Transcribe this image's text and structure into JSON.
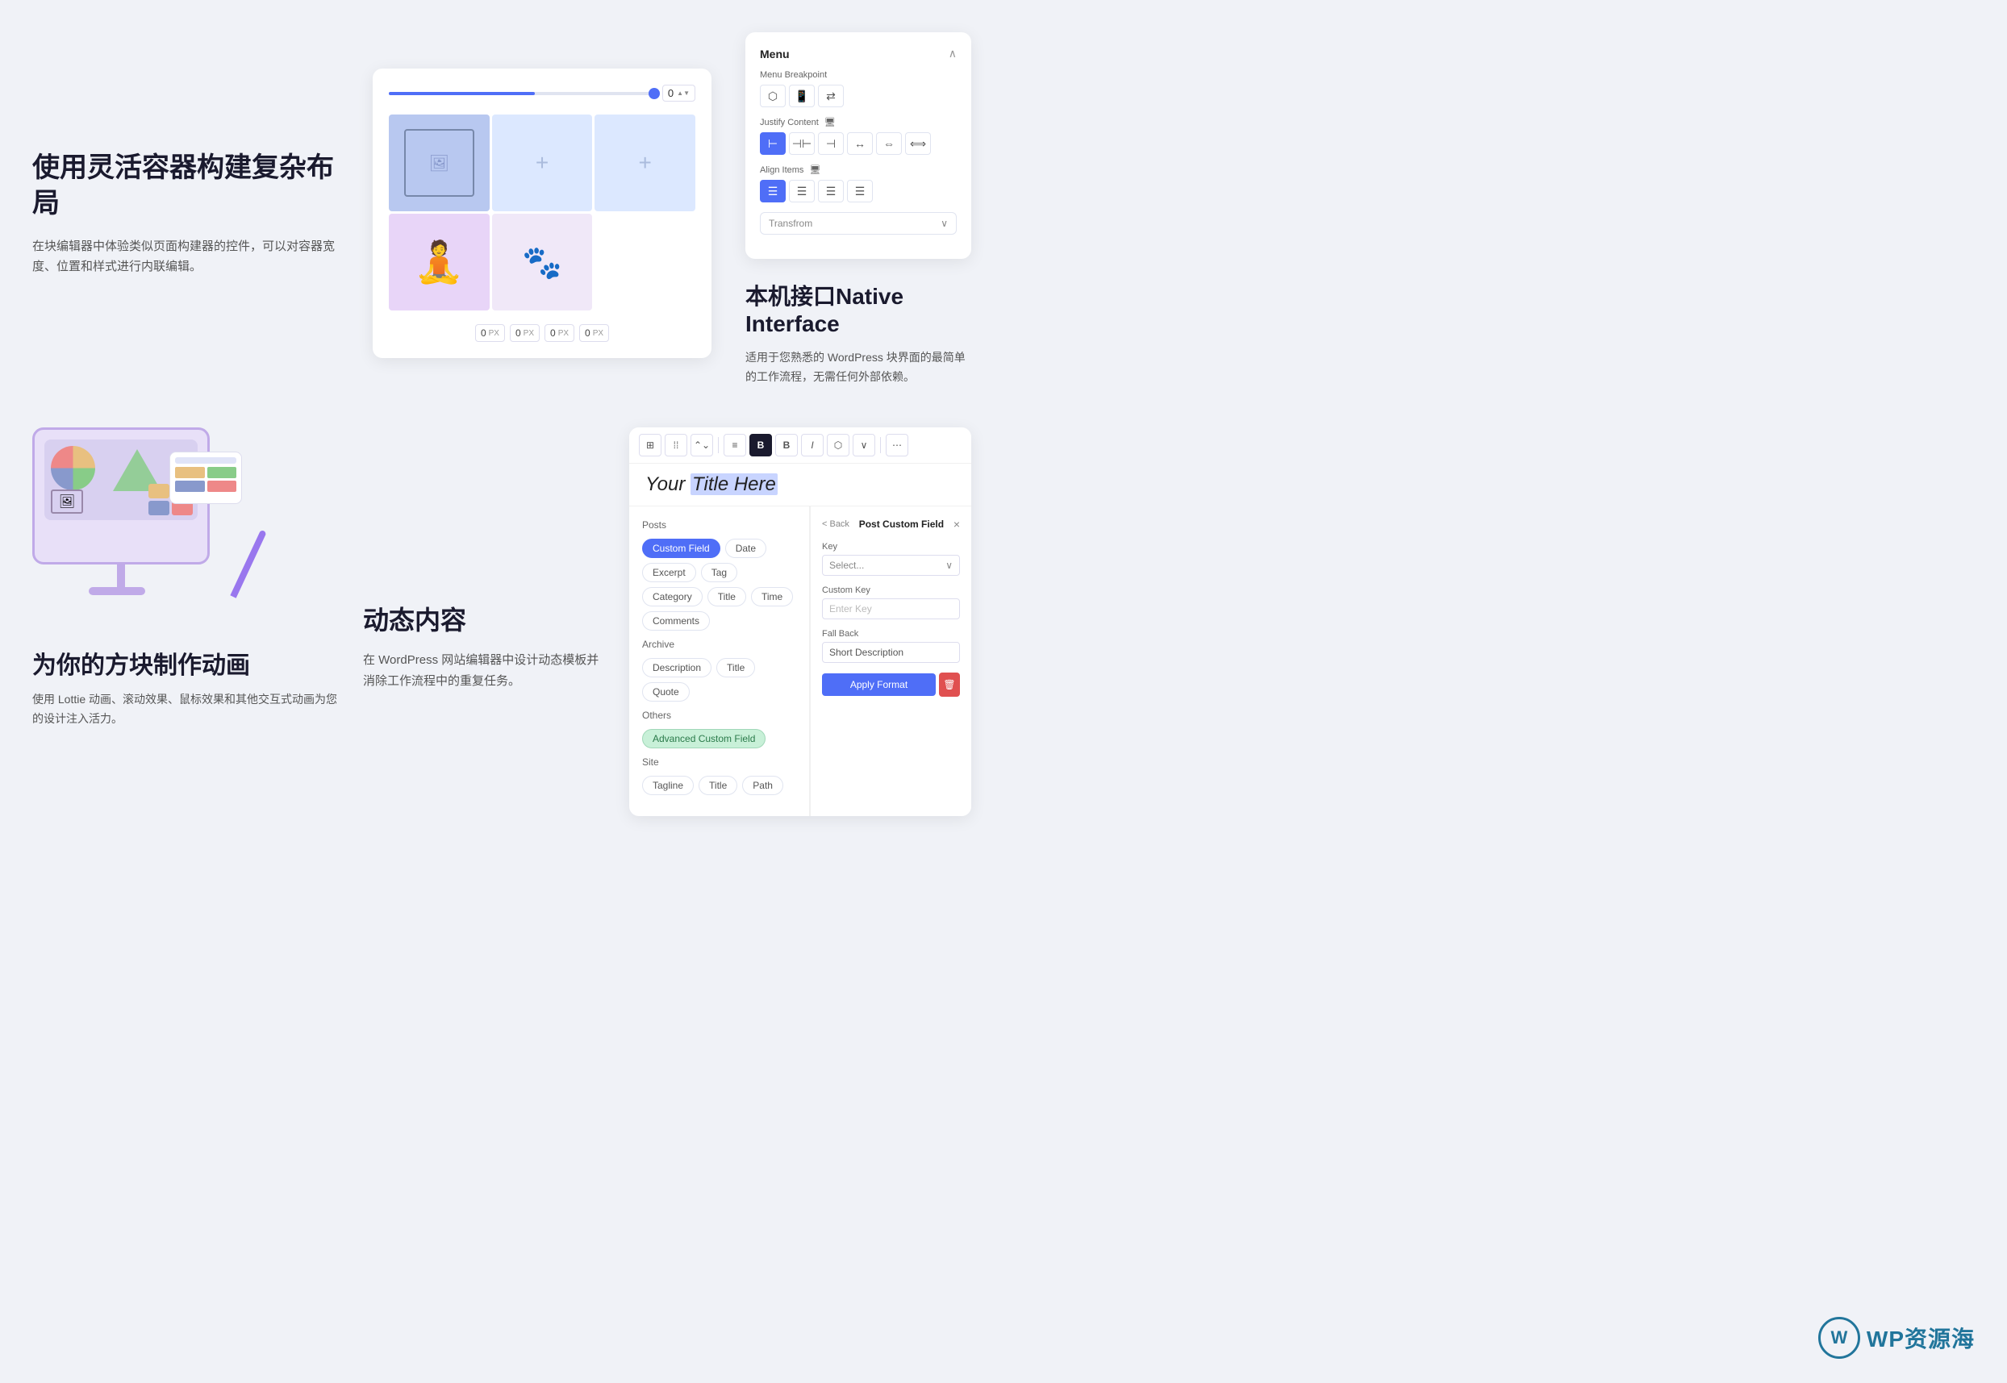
{
  "top_left": {
    "heading": "使用灵活容器构建复杂布局",
    "description": "在块编辑器中体验类似页面构建器的控件，可以对容器宽度、位置和样式进行内联编辑。"
  },
  "slider": {
    "value": "0",
    "unit": "PX"
  },
  "spacing": {
    "values": [
      "0",
      "0",
      "0",
      "0"
    ],
    "unit": "PX"
  },
  "top_right_panel": {
    "title": "Menu",
    "breakpoint_label": "Menu Breakpoint",
    "justify_label": "Justify Content",
    "align_label": "Align Items",
    "transform_label": "Transfrom"
  },
  "right_text": {
    "heading": "本机接口Native Interface",
    "description": "适用于您熟悉的 WordPress 块界面的最简单的工作流程，无需任何外部依赖。"
  },
  "bottom_left": {
    "heading": "为你的方块制作动画",
    "description": "使用 Lottie 动画、滚动效果、鼠标效果和其他交互式动画为您的设计注入活力。"
  },
  "bottom_center": {
    "heading": "动态内容",
    "description": "在 WordPress 网站编辑器中设计动态模板并消除工作流程中的重复任务。"
  },
  "editor": {
    "title_before": "Your ",
    "title_highlight": "Title Here",
    "toolbar_buttons": [
      "⊞",
      "⋮⋮",
      "∧∨",
      "≡",
      "B",
      "I",
      "⬡",
      "∨",
      "⋯"
    ],
    "posts_label": "Posts",
    "tags": [
      "Custom Field",
      "Date",
      "Excerpt",
      "Tag",
      "Category",
      "Title",
      "Time",
      "Comments"
    ],
    "archive_label": "Archive",
    "archive_tags": [
      "Description",
      "Title",
      "Quote"
    ],
    "others_label": "Others",
    "others_tags": [
      "Advanced Custom Field"
    ],
    "site_label": "Site",
    "site_tags": [
      "Tagline",
      "Title",
      "Path"
    ]
  },
  "custom_field_panel": {
    "back_text": "< Back",
    "title": "Post Custom Field",
    "close_icon": "×",
    "key_label": "Key",
    "key_placeholder": "Select...",
    "custom_key_label": "Custom Key",
    "custom_key_placeholder": "Enter Key",
    "fallback_label": "Fall Back",
    "fallback_value": "Short Description",
    "apply_label": "Apply Format",
    "delete_icon": "🗑"
  },
  "watermark": {
    "logo": "W",
    "text": "WP资源海"
  }
}
